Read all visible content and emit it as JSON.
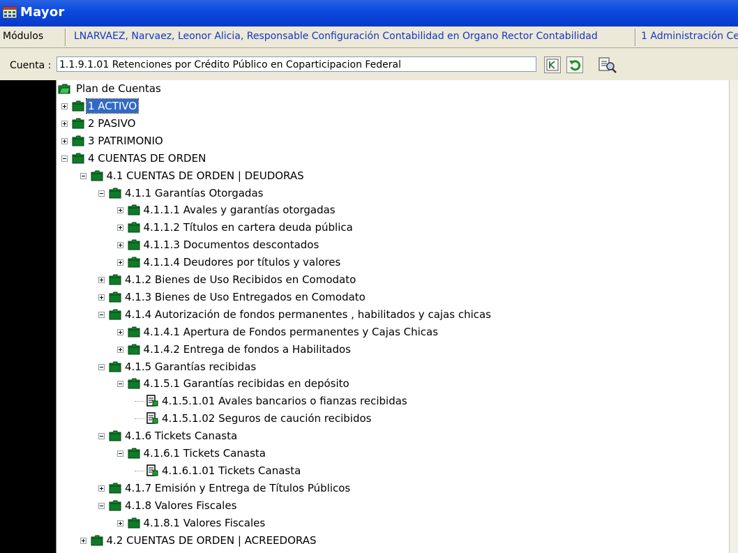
{
  "window": {
    "title": "Mayor"
  },
  "menubar": {
    "modules_label": "Módulos",
    "user_text": "LNARVAEZ, Narvaez, Leonor Alicia, Responsable Configuración Contabilidad en Organo Rector Contabilidad",
    "admin_text": "1 Administración Ce"
  },
  "cuenta": {
    "label": "Cuenta :",
    "value": "1.1.9.1.01 Retenciones por Crédito Público en Coparticipacion Federal"
  },
  "tree": {
    "root": "Plan de Cuentas",
    "nodes": [
      {
        "label": "1 ACTIVO"
      },
      {
        "label": "2 PASIVO"
      },
      {
        "label": "3 PATRIMONIO"
      },
      {
        "label": "4 CUENTAS DE ORDEN"
      },
      {
        "label": "4.1 CUENTAS DE ORDEN | DEUDORAS"
      },
      {
        "label": "4.1.1 Garantías Otorgadas"
      },
      {
        "label": "4.1.1.1 Avales y garantías otorgadas"
      },
      {
        "label": "4.1.1.2 Títulos en cartera deuda pública"
      },
      {
        "label": "4.1.1.3 Documentos descontados"
      },
      {
        "label": "4.1.1.4 Deudores por títulos y valores"
      },
      {
        "label": "4.1.2 Bienes de Uso Recibidos en Comodato"
      },
      {
        "label": "4.1.3 Bienes de Uso Entregados en Comodato"
      },
      {
        "label": "4.1.4 Autorización de fondos permanentes , habilitados y cajas chicas"
      },
      {
        "label": "4.1.4.1 Apertura de Fondos permanentes y Cajas Chicas"
      },
      {
        "label": "4.1.4.2 Entrega de fondos a Habilitados"
      },
      {
        "label": "4.1.5 Garantías recibidas"
      },
      {
        "label": "4.1.5.1 Garantías recibidas en depósito"
      },
      {
        "label": "4.1.5.1.01 Avales bancarios o fianzas recibidas"
      },
      {
        "label": "4.1.5.1.02 Seguros de caución recibidos"
      },
      {
        "label": "4.1.6 Tickets Canasta"
      },
      {
        "label": "4.1.6.1 Tickets Canasta"
      },
      {
        "label": "4.1.6.1.01 Tickets Canasta"
      },
      {
        "label": "4.1.7 Emisión y Entrega de Títulos Públicos"
      },
      {
        "label": "4.1.8 Valores Fiscales"
      },
      {
        "label": "4.1.8.1 Valores Fiscales"
      },
      {
        "label": "4.2 CUENTAS DE ORDEN | ACREEDORAS"
      }
    ]
  },
  "icons": {
    "app": "app-icon",
    "folder": "folder-icon",
    "leaf": "account-leaf-icon",
    "back": "back-arrow-icon",
    "refresh": "refresh-icon",
    "find": "find-document-icon"
  }
}
